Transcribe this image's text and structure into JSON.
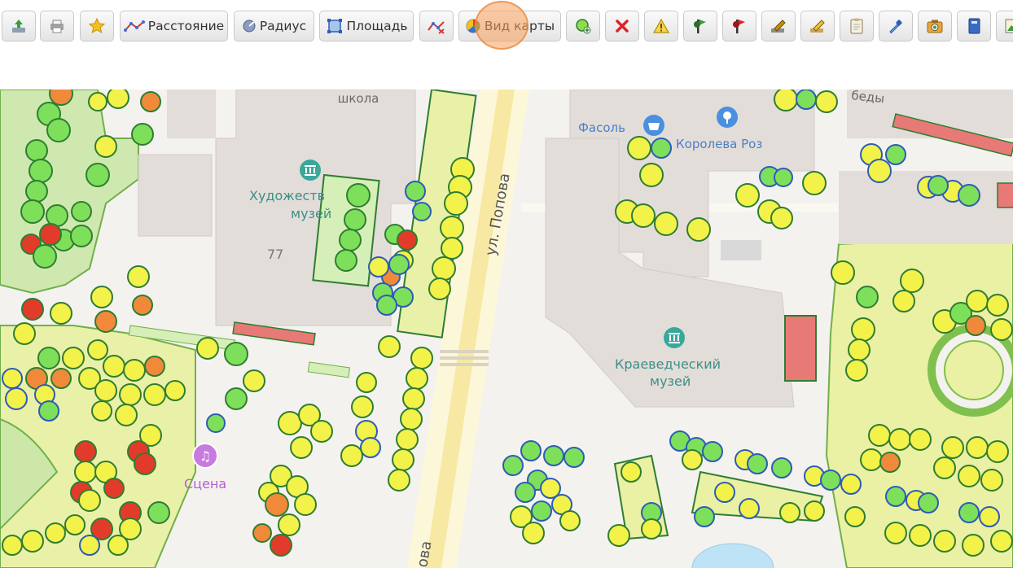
{
  "toolbar": {
    "buttons": [
      {
        "name": "export-button",
        "icon": "export-icon"
      },
      {
        "name": "print-button",
        "icon": "printer-icon"
      },
      {
        "name": "favorite-button",
        "icon": "star-icon"
      },
      {
        "name": "distance-button",
        "icon": "ruler-line-icon",
        "label": "Расстояние"
      },
      {
        "name": "radius-button",
        "icon": "radius-icon",
        "label": "Радиус"
      },
      {
        "name": "area-button",
        "icon": "area-square-icon",
        "label": "Площадь"
      },
      {
        "name": "clear-measure-button",
        "icon": "clear-measure-icon"
      },
      {
        "name": "map-view-button",
        "icon": "palette-icon",
        "label": "Вид карты"
      },
      {
        "name": "add-object-button",
        "icon": "add-tree-icon"
      },
      {
        "name": "delete-button",
        "icon": "close-icon"
      },
      {
        "name": "warning-button",
        "icon": "warning-icon"
      },
      {
        "name": "green-flag-button",
        "icon": "green-flag-icon"
      },
      {
        "name": "red-flag-button",
        "icon": "red-flag-icon"
      },
      {
        "name": "edit-tool-button",
        "icon": "pencil-icon"
      },
      {
        "name": "edit-tool-2-button",
        "icon": "pencil-edit-icon"
      },
      {
        "name": "clipboard-button",
        "icon": "clipboard-icon"
      },
      {
        "name": "pipette-button",
        "icon": "pipette-icon"
      },
      {
        "name": "photo-button",
        "icon": "photo-icon"
      },
      {
        "name": "book-button",
        "icon": "book-icon"
      },
      {
        "name": "image-button",
        "icon": "image-icon"
      }
    ]
  },
  "map": {
    "labels": {
      "school": "школа",
      "museum_art_1": "Художеств",
      "museum_art_2": "музей",
      "house_77": "77",
      "street_popova": "ул. Попова",
      "street_popova_bottom": "ова",
      "shop_fasol": "Фасоль",
      "shop_koroleva": "Королева Роз",
      "museum_local_1": "Краеведческий",
      "museum_local_2": "музей",
      "stage": "Сцена",
      "street_pobedy": "беды"
    },
    "tree_colors": {
      "healthy": "#7ee05a",
      "weak": "#f2f24a",
      "damaged": "#f08a3a",
      "dead": "#e23b2a",
      "outline": "#2f7d32",
      "outline_alt": "#2c5db4"
    }
  }
}
